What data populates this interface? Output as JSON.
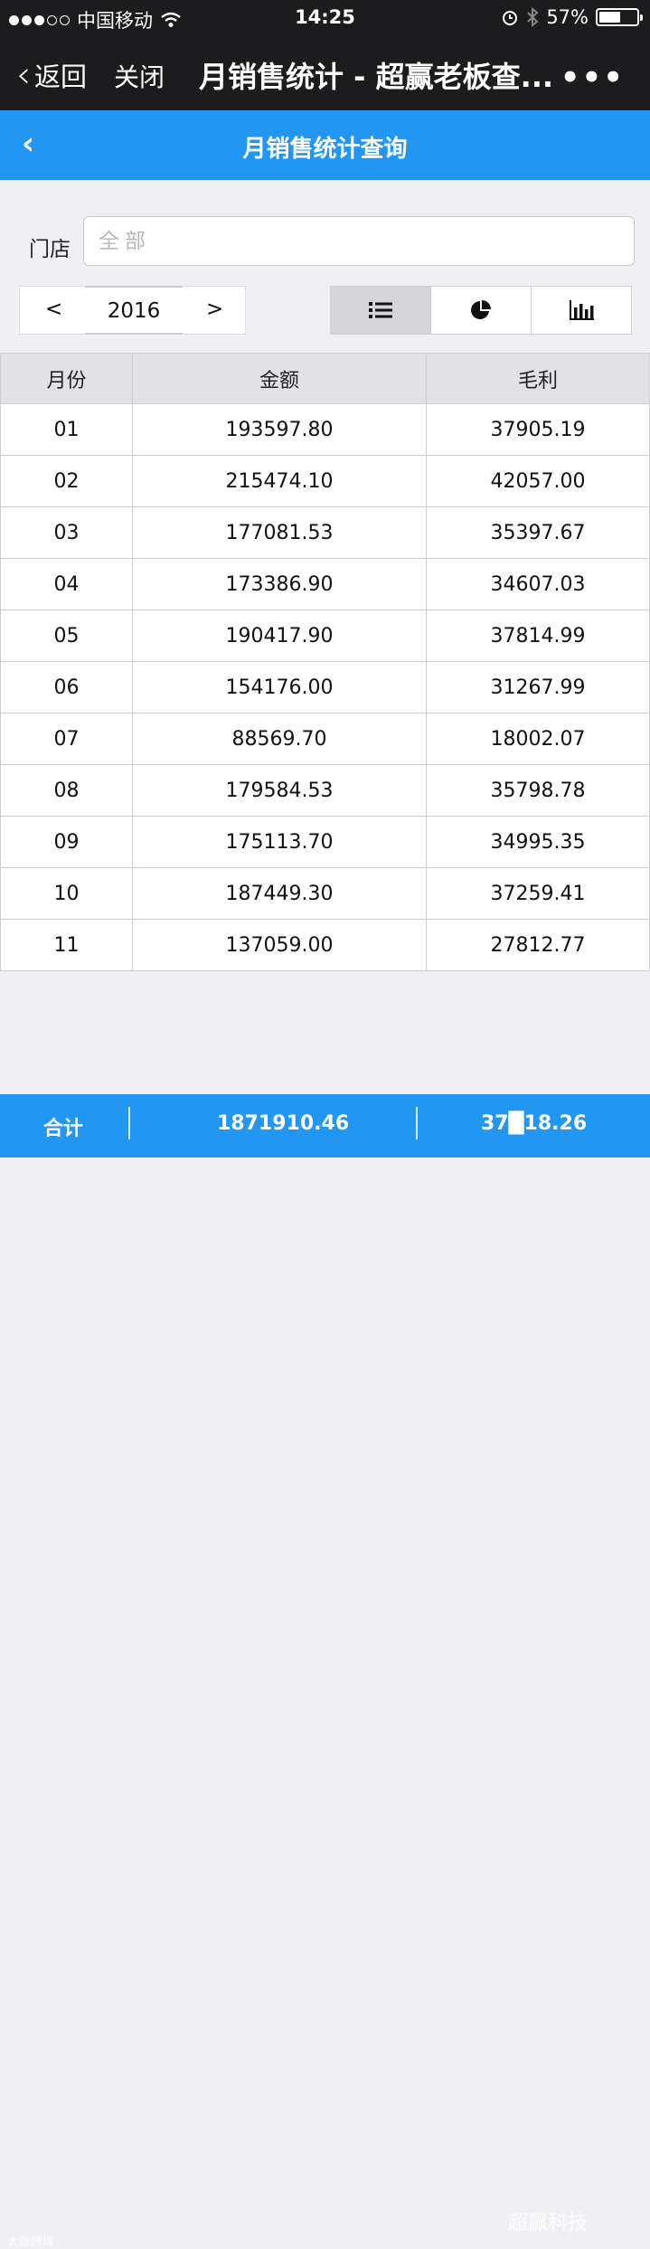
{
  "status_bar": {
    "carrier": "中国移动",
    "time": "14:25",
    "battery": "57%",
    "battery_level": 0.57
  },
  "nav": {
    "back_label": "返回",
    "close_label": "关闭",
    "title": "月销售统计 - 超赢老板查...",
    "more_label": "•••"
  },
  "page": {
    "title": "月销售统计查询",
    "back_symbol": "‹"
  },
  "filter": {
    "store_label": "门店",
    "store_placeholder": "全部",
    "store_value": ""
  },
  "year_selector": {
    "prev": "<",
    "year": "2016",
    "next": ">"
  },
  "view_toggles": [
    {
      "icon": "list-icon",
      "active": true
    },
    {
      "icon": "pie-chart-icon",
      "active": false
    },
    {
      "icon": "bar-chart-icon",
      "active": false
    }
  ],
  "table": {
    "headers": [
      "月份",
      "金额",
      "毛利"
    ],
    "rows": [
      [
        "01",
        "193597.80",
        "37905.19"
      ],
      [
        "02",
        "215474.10",
        "42057.00"
      ],
      [
        "03",
        "177081.53",
        "35397.67"
      ],
      [
        "04",
        "173386.90",
        "34607.03"
      ],
      [
        "05",
        "190417.90",
        "37814.99"
      ],
      [
        "06",
        "154176.00",
        "31267.99"
      ],
      [
        "07",
        "88569.70",
        "18002.07"
      ],
      [
        "08",
        "179584.53",
        "35798.78"
      ],
      [
        "09",
        "175113.70",
        "34995.35"
      ],
      [
        "10",
        "187449.30",
        "37259.41"
      ],
      [
        "11",
        "137059.00",
        "27812.77"
      ]
    ]
  },
  "footer": {
    "total_label": "合计",
    "total_amount": "1871910.46",
    "total_profit": "37█18.26",
    "watermark": "超赢科技",
    "watermark_small": "大数跨境"
  },
  "colors": {
    "accent": "#2196f3",
    "dark_bar": "#1c1c1e"
  }
}
